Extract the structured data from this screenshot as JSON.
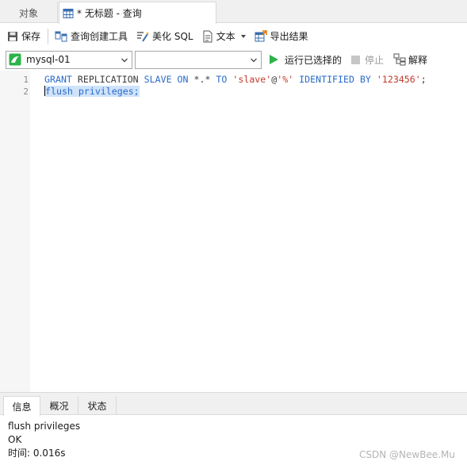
{
  "tabs": {
    "objects": "对象",
    "query": "* 无标题 - 查询"
  },
  "toolbar": {
    "save": "保存",
    "query_builder": "查询创建工具",
    "beautify_sql": "美化 SQL",
    "text": "文本",
    "export": "导出结果"
  },
  "connection": {
    "name": "mysql-01",
    "database": "",
    "run_selected": "运行已选择的",
    "stop": "停止",
    "explain": "解释"
  },
  "editor": {
    "line_numbers": [
      "1",
      "2"
    ],
    "line1": {
      "kw1": "GRANT",
      "p1": " REPLICATION ",
      "kw2": "SLAVE",
      "p2": " ",
      "kw3": "ON",
      "p3": " *.* ",
      "kw4": "TO",
      "p4": " ",
      "s1": "'slave'",
      "p5": "@",
      "s2": "'%'",
      "p6": " ",
      "kw5": "IDENTIFIED BY",
      "p7": " ",
      "s3": "'123456'",
      "p8": ";"
    },
    "line2": "flush privileges;"
  },
  "bottom_tabs": {
    "info": "信息",
    "profile": "概况",
    "status": "状态"
  },
  "messages": {
    "statement": "flush privileges",
    "result": "OK",
    "time": "时间: 0.016s"
  },
  "watermark": "CSDN @NewBee.Mu"
}
